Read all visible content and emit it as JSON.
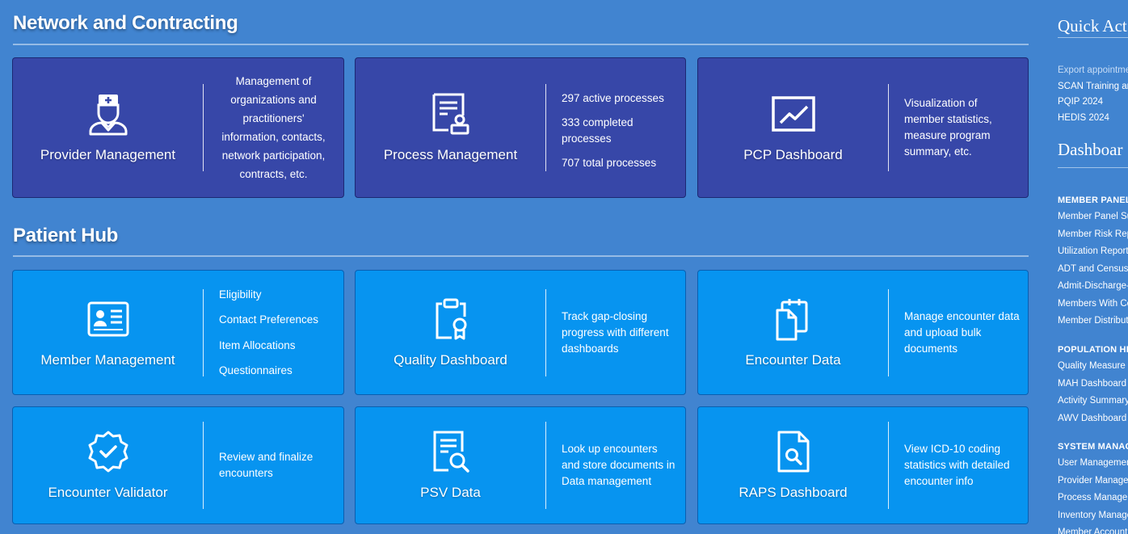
{
  "network": {
    "title": "Network and Contracting",
    "cards": [
      {
        "title": "Provider Management",
        "icon": "nurse-icon",
        "desc": "Management of organizations and practitioners' information, contacts, network participation, contracts, etc."
      },
      {
        "title": "Process Management",
        "icon": "certificate-document-icon",
        "stats": [
          "297 active processes",
          "333 completed processes",
          "707 total processes"
        ]
      },
      {
        "title": "PCP Dashboard",
        "icon": "line-chart-icon",
        "desc": "Visualization of member statistics, measure program summary, etc."
      }
    ]
  },
  "patient_hub": {
    "title": "Patient Hub",
    "cards": [
      {
        "title": "Member Management",
        "icon": "id-card-icon",
        "links": [
          "Eligibility",
          "Contact Preferences",
          "Item Allocations",
          "Questionnaires"
        ]
      },
      {
        "title": "Quality Dashboard",
        "icon": "clipboard-award-icon",
        "desc": "Track gap-closing progress with different dashboards"
      },
      {
        "title": "Encounter Data",
        "icon": "documents-icon",
        "desc": "Manage encounter data and upload bulk documents"
      },
      {
        "title": "Encounter Validator",
        "icon": "verified-badge-icon",
        "desc": "Review and finalize encounters"
      },
      {
        "title": "PSV Data",
        "icon": "document-search-icon",
        "desc": "Look up encounters and store documents in Data management"
      },
      {
        "title": "RAPS Dashboard",
        "icon": "file-search-icon",
        "desc": "View ICD-10 coding statistics with detailed encounter info"
      }
    ]
  },
  "quick_actions": {
    "title": "Quick Act",
    "links": [
      "Export appointme",
      "SCAN Training an",
      "PQIP 2024",
      "HEDIS 2024"
    ]
  },
  "dashboards": {
    "title": "Dashboar",
    "groups": [
      {
        "heading": "MEMBER PANEL",
        "items": [
          "Member Panel Su",
          "Member Risk Rep",
          "Utilization Report",
          "ADT and Census R",
          "Admit-Discharge-T",
          "Members With Co",
          "Member Distributi"
        ]
      },
      {
        "heading": "POPULATION HEA",
        "items": [
          "Quality Measure",
          "MAH Dashboard",
          "Activity Summary",
          "AWV Dashboard"
        ]
      },
      {
        "heading": "SYSTEM MANAGE",
        "items": [
          "User Managemen",
          "Provider Manager",
          "Process Manager",
          "Inventory Manage",
          "Member Account"
        ]
      }
    ]
  }
}
